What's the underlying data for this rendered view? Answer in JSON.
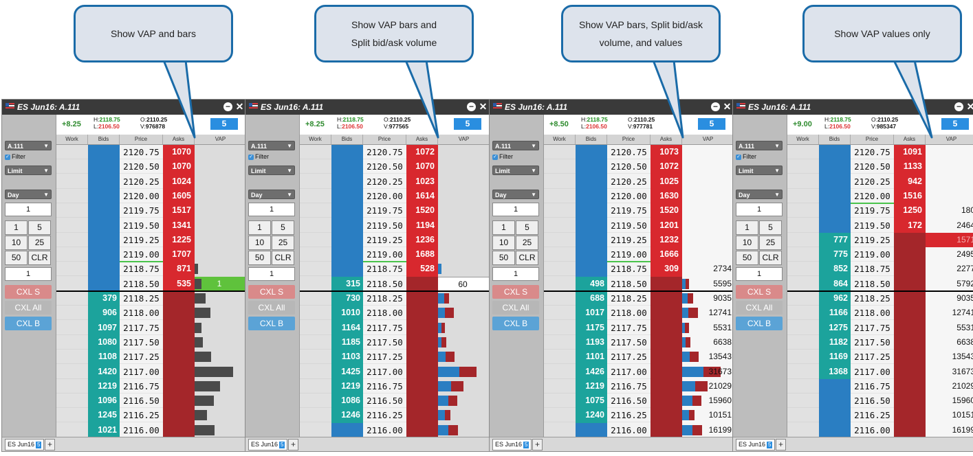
{
  "callouts": [
    {
      "lines": [
        "Show VAP and bars"
      ]
    },
    {
      "lines": [
        "Show VAP bars and",
        "Split bid/ask volume"
      ]
    },
    {
      "lines": [
        "Show VAP bars, Split bid/ask",
        "volume, and values"
      ]
    },
    {
      "lines": [
        "Show VAP values only"
      ]
    }
  ],
  "colors": {
    "bid": "#2a7ec2",
    "bid_qty": "#1ca39c",
    "ask_qty": "#d8282e",
    "ask": "#a4262a",
    "vap_bar": "#4a4a4a",
    "highlight": "#5fc23c"
  },
  "common": {
    "contract_title": "ES Jun16: A.111",
    "account": "A.111",
    "filter_label": "Filter",
    "order_type": "Limit",
    "tif": "Day",
    "qty_top": "1",
    "qty_bottom": "1",
    "qty_buttons": [
      "1",
      "5",
      "10",
      "25",
      "50",
      "CLR"
    ],
    "cxl_s": "CXL S",
    "cxl_all": "CXL All",
    "cxl_b": "CXL B",
    "headers": {
      "work": "Work",
      "bids": "Bids",
      "price": "Price",
      "asks": "Asks",
      "vap": "VAP"
    },
    "tab_label": "ES Jun16",
    "tab_count": "5",
    "add_tab": "+",
    "volume_badge": "5",
    "h_label": "H:",
    "l_label": "L:",
    "o_label": "O:",
    "v_label": "V:",
    "high": "2118.75",
    "low": "2106.50",
    "open": "2110.25"
  },
  "panels": [
    {
      "change": "+8.25",
      "volume": "976878",
      "vap_mode": "bars",
      "rows": [
        {
          "price": "2120.75",
          "ask": "1070",
          "bid": "",
          "vap": 0,
          "vap_text": "",
          "bid_share": 0
        },
        {
          "price": "2120.50",
          "ask": "1070",
          "bid": "",
          "vap": 0,
          "vap_text": "",
          "bid_share": 0
        },
        {
          "price": "2120.25",
          "ask": "1024",
          "bid": "",
          "vap": 0,
          "vap_text": "",
          "bid_share": 0
        },
        {
          "price": "2120.00",
          "ask": "1605",
          "bid": "",
          "vap": 0,
          "vap_text": "",
          "bid_share": 0
        },
        {
          "price": "2119.75",
          "ask": "1517",
          "bid": "",
          "vap": 0,
          "vap_text": "",
          "bid_share": 0
        },
        {
          "price": "2119.50",
          "ask": "1341",
          "bid": "",
          "vap": 0,
          "vap_text": "",
          "bid_share": 0
        },
        {
          "price": "2119.25",
          "ask": "1225",
          "bid": "",
          "vap": 0,
          "vap_text": "",
          "bid_share": 0
        },
        {
          "price": "2119.00",
          "ask": "1707",
          "bid": "",
          "vap": 0,
          "vap_text": "",
          "bid_share": 0
        },
        {
          "price": "2118.75",
          "ask": "871",
          "bid": "",
          "vap": 2734,
          "vap_text": "",
          "bid_share": 0
        },
        {
          "price": "2118.50",
          "ask": "535",
          "bid": "",
          "vap": 5595,
          "vap_text": "1",
          "bid_share": 0,
          "highlight": true
        },
        {
          "price": "2118.25",
          "ask": "",
          "bid": "379",
          "vap": 9035,
          "vap_text": "",
          "bid_share": 0
        },
        {
          "price": "2118.00",
          "ask": "",
          "bid": "906",
          "vap": 12741,
          "vap_text": "",
          "bid_share": 0
        },
        {
          "price": "2117.75",
          "ask": "",
          "bid": "1097",
          "vap": 5531,
          "vap_text": "",
          "bid_share": 0
        },
        {
          "price": "2117.50",
          "ask": "",
          "bid": "1080",
          "vap": 6638,
          "vap_text": "",
          "bid_share": 0
        },
        {
          "price": "2117.25",
          "ask": "",
          "bid": "1108",
          "vap": 13543,
          "vap_text": "",
          "bid_share": 0
        },
        {
          "price": "2117.00",
          "ask": "",
          "bid": "1420",
          "vap": 31673,
          "vap_text": "",
          "bid_share": 0
        },
        {
          "price": "2116.75",
          "ask": "",
          "bid": "1219",
          "vap": 21029,
          "vap_text": "",
          "bid_share": 0
        },
        {
          "price": "2116.50",
          "ask": "",
          "bid": "1096",
          "vap": 15960,
          "vap_text": "",
          "bid_share": 0
        },
        {
          "price": "2116.25",
          "ask": "",
          "bid": "1245",
          "vap": 10151,
          "vap_text": "",
          "bid_share": 0
        },
        {
          "price": "2116.00",
          "ask": "",
          "bid": "1021",
          "vap": 16199,
          "vap_text": "",
          "bid_share": 0
        }
      ]
    },
    {
      "change": "+8.25",
      "volume": "977565",
      "vap_mode": "split",
      "rows": [
        {
          "price": "2120.75",
          "ask": "1072",
          "bid": "",
          "vap": 0,
          "vap_text": "",
          "bid_share": 0
        },
        {
          "price": "2120.50",
          "ask": "1070",
          "bid": "",
          "vap": 0,
          "vap_text": "",
          "bid_share": 0
        },
        {
          "price": "2120.25",
          "ask": "1023",
          "bid": "",
          "vap": 0,
          "vap_text": "",
          "bid_share": 0
        },
        {
          "price": "2120.00",
          "ask": "1614",
          "bid": "",
          "vap": 0,
          "vap_text": "",
          "bid_share": 0
        },
        {
          "price": "2119.75",
          "ask": "1520",
          "bid": "",
          "vap": 0,
          "vap_text": "",
          "bid_share": 0
        },
        {
          "price": "2119.50",
          "ask": "1194",
          "bid": "",
          "vap": 0,
          "vap_text": "",
          "bid_share": 0
        },
        {
          "price": "2119.25",
          "ask": "1236",
          "bid": "",
          "vap": 0,
          "vap_text": "",
          "bid_share": 0
        },
        {
          "price": "2119.00",
          "ask": "1688",
          "bid": "",
          "vap": 0,
          "vap_text": "",
          "bid_share": 0
        },
        {
          "price": "2118.75",
          "ask": "528",
          "bid": "",
          "vap": 2734,
          "vap_text": "",
          "bid_share": 1
        },
        {
          "price": "2118.50",
          "ask": "",
          "bid": "315",
          "vap": 0,
          "vap_text": "60",
          "bid_share": 0,
          "boxed": true
        },
        {
          "price": "2118.25",
          "ask": "",
          "bid": "730",
          "vap": 9035,
          "vap_text": "",
          "bid_share": 0.55
        },
        {
          "price": "2118.00",
          "ask": "",
          "bid": "1010",
          "vap": 12741,
          "vap_text": "",
          "bid_share": 0.45
        },
        {
          "price": "2117.75",
          "ask": "",
          "bid": "1164",
          "vap": 5531,
          "vap_text": "",
          "bid_share": 0.45
        },
        {
          "price": "2117.50",
          "ask": "",
          "bid": "1185",
          "vap": 6638,
          "vap_text": "",
          "bid_share": 0.45
        },
        {
          "price": "2117.25",
          "ask": "",
          "bid": "1103",
          "vap": 13543,
          "vap_text": "",
          "bid_share": 0.45
        },
        {
          "price": "2117.00",
          "ask": "",
          "bid": "1425",
          "vap": 31673,
          "vap_text": "",
          "bid_share": 0.55
        },
        {
          "price": "2116.75",
          "ask": "",
          "bid": "1219",
          "vap": 21029,
          "vap_text": "",
          "bid_share": 0.5
        },
        {
          "price": "2116.50",
          "ask": "",
          "bid": "1086",
          "vap": 15960,
          "vap_text": "",
          "bid_share": 0.55
        },
        {
          "price": "2116.25",
          "ask": "",
          "bid": "1246",
          "vap": 10151,
          "vap_text": "",
          "bid_share": 0.55
        },
        {
          "price": "2116.00",
          "ask": "",
          "bid": "",
          "vap": 16199,
          "vap_text": "",
          "bid_share": 0.5
        }
      ]
    },
    {
      "change": "+8.50",
      "volume": "977781",
      "vap_mode": "split_values",
      "rows": [
        {
          "price": "2120.75",
          "ask": "1073",
          "bid": "",
          "vap": 0,
          "vap_text": "",
          "bid_share": 0
        },
        {
          "price": "2120.50",
          "ask": "1072",
          "bid": "",
          "vap": 0,
          "vap_text": "",
          "bid_share": 0
        },
        {
          "price": "2120.25",
          "ask": "1025",
          "bid": "",
          "vap": 0,
          "vap_text": "",
          "bid_share": 0
        },
        {
          "price": "2120.00",
          "ask": "1630",
          "bid": "",
          "vap": 0,
          "vap_text": "",
          "bid_share": 0
        },
        {
          "price": "2119.75",
          "ask": "1520",
          "bid": "",
          "vap": 0,
          "vap_text": "",
          "bid_share": 0
        },
        {
          "price": "2119.50",
          "ask": "1201",
          "bid": "",
          "vap": 0,
          "vap_text": "",
          "bid_share": 0
        },
        {
          "price": "2119.25",
          "ask": "1232",
          "bid": "",
          "vap": 0,
          "vap_text": "",
          "bid_share": 0
        },
        {
          "price": "2119.00",
          "ask": "1666",
          "bid": "",
          "vap": 0,
          "vap_text": "",
          "bid_share": 0
        },
        {
          "price": "2118.75",
          "ask": "309",
          "bid": "",
          "vap": 0,
          "vap_text": "2734",
          "bid_share": 0
        },
        {
          "price": "2118.50",
          "ask": "",
          "bid": "498",
          "vap": 5595,
          "vap_text": "5595",
          "bid_share": 0.5
        },
        {
          "price": "2118.25",
          "ask": "",
          "bid": "688",
          "vap": 9035,
          "vap_text": "9035",
          "bid_share": 0.5
        },
        {
          "price": "2118.00",
          "ask": "",
          "bid": "1017",
          "vap": 12741,
          "vap_text": "12741",
          "bid_share": 0.4
        },
        {
          "price": "2117.75",
          "ask": "",
          "bid": "1175",
          "vap": 5531,
          "vap_text": "5531",
          "bid_share": 0.4
        },
        {
          "price": "2117.50",
          "ask": "",
          "bid": "1193",
          "vap": 6638,
          "vap_text": "6638",
          "bid_share": 0.4
        },
        {
          "price": "2117.25",
          "ask": "",
          "bid": "1101",
          "vap": 13543,
          "vap_text": "13543",
          "bid_share": 0.45
        },
        {
          "price": "2117.00",
          "ask": "",
          "bid": "1426",
          "vap": 31673,
          "vap_text": "31673",
          "bid_share": 0.55
        },
        {
          "price": "2116.75",
          "ask": "",
          "bid": "1219",
          "vap": 21029,
          "vap_text": "21029",
          "bid_share": 0.5
        },
        {
          "price": "2116.50",
          "ask": "",
          "bid": "1075",
          "vap": 15960,
          "vap_text": "15960",
          "bid_share": 0.55
        },
        {
          "price": "2116.25",
          "ask": "",
          "bid": "1240",
          "vap": 10151,
          "vap_text": "10151",
          "bid_share": 0.55
        },
        {
          "price": "2116.00",
          "ask": "",
          "bid": "",
          "vap": 16199,
          "vap_text": "16199",
          "bid_share": 0.5
        }
      ]
    },
    {
      "change": "+9.00",
      "volume": "985347",
      "vap_mode": "values",
      "rows": [
        {
          "price": "2120.75",
          "ask": "1091",
          "bid": "",
          "vap": 0,
          "vap_text": "",
          "bid_share": 0
        },
        {
          "price": "2120.50",
          "ask": "1133",
          "bid": "",
          "vap": 0,
          "vap_text": "",
          "bid_share": 0
        },
        {
          "price": "2120.25",
          "ask": "942",
          "bid": "",
          "vap": 0,
          "vap_text": "",
          "bid_share": 0
        },
        {
          "price": "2120.00",
          "ask": "1516",
          "bid": "",
          "vap": 0,
          "vap_text": "",
          "bid_share": 0
        },
        {
          "price": "2119.75",
          "ask": "1250",
          "bid": "",
          "vap": 0,
          "vap_text": "180",
          "bid_share": 0
        },
        {
          "price": "2119.50",
          "ask": "172",
          "bid": "",
          "vap": 0,
          "vap_text": "2464",
          "bid_share": 0
        },
        {
          "price": "2119.25",
          "ask": "",
          "bid": "777",
          "vap": 0,
          "vap_text": "1571",
          "bid_share": 0,
          "redcell": true
        },
        {
          "price": "2119.00",
          "ask": "",
          "bid": "775",
          "vap": 0,
          "vap_text": "2495",
          "bid_share": 0
        },
        {
          "price": "2118.75",
          "ask": "",
          "bid": "852",
          "vap": 0,
          "vap_text": "2277",
          "bid_share": 0
        },
        {
          "price": "2118.50",
          "ask": "",
          "bid": "864",
          "vap": 0,
          "vap_text": "5792",
          "bid_share": 0
        },
        {
          "price": "2118.25",
          "ask": "",
          "bid": "962",
          "vap": 0,
          "vap_text": "9035",
          "bid_share": 0
        },
        {
          "price": "2118.00",
          "ask": "",
          "bid": "1166",
          "vap": 0,
          "vap_text": "12741",
          "bid_share": 0
        },
        {
          "price": "2117.75",
          "ask": "",
          "bid": "1275",
          "vap": 0,
          "vap_text": "5531",
          "bid_share": 0
        },
        {
          "price": "2117.50",
          "ask": "",
          "bid": "1182",
          "vap": 0,
          "vap_text": "6638",
          "bid_share": 0
        },
        {
          "price": "2117.25",
          "ask": "",
          "bid": "1169",
          "vap": 0,
          "vap_text": "13543",
          "bid_share": 0
        },
        {
          "price": "2117.00",
          "ask": "",
          "bid": "1368",
          "vap": 0,
          "vap_text": "31673",
          "bid_share": 0
        },
        {
          "price": "2116.75",
          "ask": "",
          "bid": "",
          "vap": 0,
          "vap_text": "21029",
          "bid_share": 0
        },
        {
          "price": "2116.50",
          "ask": "",
          "bid": "",
          "vap": 0,
          "vap_text": "15960",
          "bid_share": 0
        },
        {
          "price": "2116.25",
          "ask": "",
          "bid": "",
          "vap": 0,
          "vap_text": "10151",
          "bid_share": 0
        },
        {
          "price": "2116.00",
          "ask": "",
          "bid": "",
          "vap": 0,
          "vap_text": "16199",
          "bid_share": 0
        }
      ]
    }
  ]
}
